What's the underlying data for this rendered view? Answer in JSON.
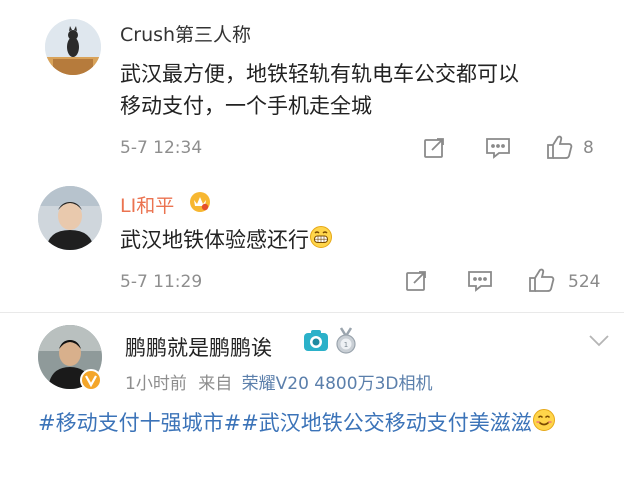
{
  "comments": [
    {
      "username": "Crush第三人称",
      "text": "武汉最方便，地铁轻轨有轨电车公交都可以移动支付，一个手机走全城",
      "line1": "武汉最方便，地铁轻轨有轨电车公交都可以",
      "line2": "移动支付，一个手机走全城",
      "time": "5-7 12:34",
      "likes": "8"
    },
    {
      "username": "LI和平",
      "text": "武汉地铁体验感还行",
      "time": "5-7 11:29",
      "likes": "524"
    }
  ],
  "post": {
    "username": "鹏鹏就是鹏鹏诶",
    "time": "1小时前",
    "from_label": "来自",
    "device": "荣耀V20 4800万3D相机",
    "topic1": "#移动支付十强城市#",
    "topic2": "#武汉地铁公交移动支付美滋滋"
  },
  "colors": {
    "vip_name": "#eb7350",
    "link_blue": "#3b73b8",
    "device_blue": "#5b7fab",
    "gray_text": "#8e8e8e",
    "avatar_badge": "#f4a62a"
  },
  "icons": [
    "share-icon",
    "comment-icon",
    "like-icon",
    "crown-badge-icon",
    "grin-emoji-icon",
    "camera-badge-icon",
    "medal-badge-icon",
    "chevron-down-icon",
    "avatar-badge-icon",
    "smile-emoji-icon"
  ]
}
